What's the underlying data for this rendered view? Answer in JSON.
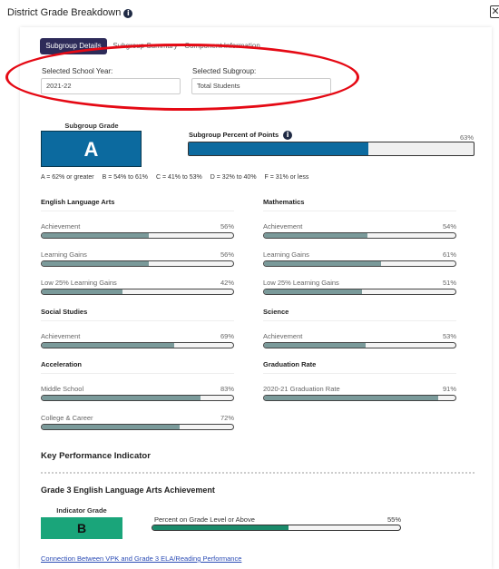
{
  "header": {
    "title": "District Grade Breakdown",
    "info_glyph": "i",
    "close_glyph": "✕"
  },
  "tabs": [
    {
      "label": "Subgroup Details",
      "active": true
    },
    {
      "label": "Subgroup Summary",
      "active": false
    },
    {
      "label": "Component Information",
      "active": false
    }
  ],
  "filters": {
    "school_year_label": "Selected School Year:",
    "school_year_value": "2021-22",
    "subgroup_label": "Selected Subgroup:",
    "subgroup_value": "Total Students"
  },
  "subgroup_grade": {
    "label": "Subgroup Grade",
    "grade": "A",
    "color": "#0c6a9f"
  },
  "percent_of_points": {
    "title": "Subgroup Percent of Points",
    "value": 63,
    "display": "63%"
  },
  "legend": [
    "A = 62% or greater",
    "B = 54% to 61%",
    "C = 41% to 53%",
    "D = 32% to 40%",
    "F = 31% or less"
  ],
  "sections": {
    "ela": {
      "title": "English Language Arts",
      "metrics": [
        {
          "label": "Achievement",
          "value": 56,
          "display": "56%"
        },
        {
          "label": "Learning Gains",
          "value": 56,
          "display": "56%"
        },
        {
          "label": "Low 25% Learning Gains",
          "value": 42,
          "display": "42%"
        }
      ]
    },
    "math": {
      "title": "Mathematics",
      "metrics": [
        {
          "label": "Achievement",
          "value": 54,
          "display": "54%"
        },
        {
          "label": "Learning Gains",
          "value": 61,
          "display": "61%"
        },
        {
          "label": "Low 25% Learning Gains",
          "value": 51,
          "display": "51%"
        }
      ]
    },
    "social": {
      "title": "Social Studies",
      "metrics": [
        {
          "label": "Achievement",
          "value": 69,
          "display": "69%"
        }
      ]
    },
    "science": {
      "title": "Science",
      "metrics": [
        {
          "label": "Achievement",
          "value": 53,
          "display": "53%"
        }
      ]
    },
    "accel": {
      "title": "Acceleration",
      "metrics": [
        {
          "label": "Middle School",
          "value": 83,
          "display": "83%"
        },
        {
          "label": "College & Career",
          "value": 72,
          "display": "72%"
        }
      ]
    },
    "grad": {
      "title": "Graduation Rate",
      "metrics": [
        {
          "label": "2020-21 Graduation Rate",
          "value": 91,
          "display": "91%"
        }
      ]
    }
  },
  "kpi": {
    "title": "Key Performance Indicator",
    "subtitle": "Grade 3 English Language Arts Achievement",
    "indicator_label": "Indicator Grade",
    "indicator_grade": "B",
    "indicator_color": "#1aa57a",
    "bar_label": "Percent on Grade Level or Above",
    "bar_value": 55,
    "bar_display": "55%",
    "link": "Connection Between VPK and Grade 3 ELA/Reading Performance"
  },
  "colors": {
    "tab_active": "#2d2b59",
    "metric_fill": "#7a9a9a",
    "annotation_ellipse": "#e50914"
  }
}
